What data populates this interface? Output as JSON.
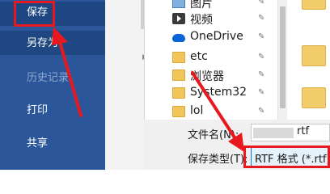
{
  "left_menu": {
    "save": "保存",
    "save_as": "另存为",
    "history": "历史记录",
    "print": "打印",
    "share": "共享"
  },
  "nav_pane": {
    "items": [
      {
        "label": "图片",
        "icon": "picture-icon"
      },
      {
        "label": "视频",
        "icon": "video-icon"
      },
      {
        "label": "OneDrive",
        "icon": "onedrive-icon"
      },
      {
        "label": "etc",
        "icon": "folder-icon"
      },
      {
        "label": "浏览器",
        "icon": "folder-icon"
      },
      {
        "label": "System32",
        "icon": "folder-icon"
      },
      {
        "label": "lol",
        "icon": "folder-icon"
      }
    ],
    "pin_glyph": "📌"
  },
  "bottom": {
    "filename_label": "文件名(N):",
    "filename_ext": "rtf",
    "savetype_label": "保存类型(T):",
    "savetype_value": "RTF 格式 (*.rtf)"
  },
  "colors": {
    "menu_bg": "#2b579a",
    "annotation": "#e8191e"
  }
}
